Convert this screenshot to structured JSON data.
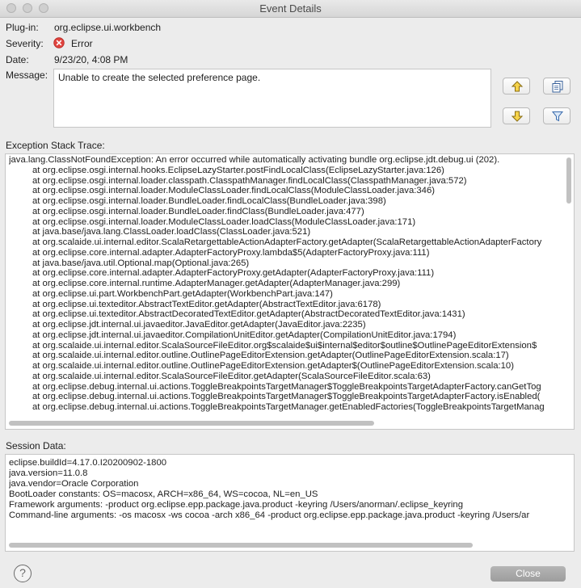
{
  "window": {
    "title": "Event Details"
  },
  "details": {
    "plugin_label": "Plug-in:",
    "plugin_value": "org.eclipse.ui.workbench",
    "severity_label": "Severity:",
    "severity_value": "Error",
    "date_label": "Date:",
    "date_value": "9/23/20, 4:08 PM",
    "message_label": "Message:",
    "message_value": "Unable to create the selected preference page."
  },
  "icons": {
    "severity": "error-icon",
    "previous": "arrow-up-icon",
    "next": "arrow-down-icon",
    "copy": "copy-icon",
    "filter": "filter-icon",
    "help": "help-icon"
  },
  "trace": {
    "label": "Exception Stack Trace:",
    "lines": [
      "java.lang.ClassNotFoundException: An error occurred while automatically activating bundle org.eclipse.jdt.debug.ui (202).",
      "at org.eclipse.osgi.internal.hooks.EclipseLazyStarter.postFindLocalClass(EclipseLazyStarter.java:126)",
      "at org.eclipse.osgi.internal.loader.classpath.ClasspathManager.findLocalClass(ClasspathManager.java:572)",
      "at org.eclipse.osgi.internal.loader.ModuleClassLoader.findLocalClass(ModuleClassLoader.java:346)",
      "at org.eclipse.osgi.internal.loader.BundleLoader.findLocalClass(BundleLoader.java:398)",
      "at org.eclipse.osgi.internal.loader.BundleLoader.findClass(BundleLoader.java:477)",
      "at org.eclipse.osgi.internal.loader.ModuleClassLoader.loadClass(ModuleClassLoader.java:171)",
      "at java.base/java.lang.ClassLoader.loadClass(ClassLoader.java:521)",
      "at org.scalaide.ui.internal.editor.ScalaRetargettableActionAdapterFactory.getAdapter(ScalaRetargettableActionAdapterFactory",
      "at org.eclipse.core.internal.adapter.AdapterFactoryProxy.lambda$5(AdapterFactoryProxy.java:111)",
      "at java.base/java.util.Optional.map(Optional.java:265)",
      "at org.eclipse.core.internal.adapter.AdapterFactoryProxy.getAdapter(AdapterFactoryProxy.java:111)",
      "at org.eclipse.core.internal.runtime.AdapterManager.getAdapter(AdapterManager.java:299)",
      "at org.eclipse.ui.part.WorkbenchPart.getAdapter(WorkbenchPart.java:147)",
      "at org.eclipse.ui.texteditor.AbstractTextEditor.getAdapter(AbstractTextEditor.java:6178)",
      "at org.eclipse.ui.texteditor.AbstractDecoratedTextEditor.getAdapter(AbstractDecoratedTextEditor.java:1431)",
      "at org.eclipse.jdt.internal.ui.javaeditor.JavaEditor.getAdapter(JavaEditor.java:2235)",
      "at org.eclipse.jdt.internal.ui.javaeditor.CompilationUnitEditor.getAdapter(CompilationUnitEditor.java:1794)",
      "at org.scalaide.ui.internal.editor.ScalaSourceFileEditor.org$scalaide$ui$internal$editor$outline$OutlinePageEditorExtension$",
      "at org.scalaide.ui.internal.editor.outline.OutlinePageEditorExtension.getAdapter(OutlinePageEditorExtension.scala:17)",
      "at org.scalaide.ui.internal.editor.outline.OutlinePageEditorExtension.getAdapter$(OutlinePageEditorExtension.scala:10)",
      "at org.scalaide.ui.internal.editor.ScalaSourceFileEditor.getAdapter(ScalaSourceFileEditor.scala:63)",
      "at org.eclipse.debug.internal.ui.actions.ToggleBreakpointsTargetManager$ToggleBreakpointsTargetAdapterFactory.canGetTog",
      "at org.eclipse.debug.internal.ui.actions.ToggleBreakpointsTargetManager$ToggleBreakpointsTargetAdapterFactory.isEnabled(",
      "at org.eclipse.debug.internal.ui.actions.ToggleBreakpointsTargetManager.getEnabledFactories(ToggleBreakpointsTargetManag"
    ]
  },
  "session": {
    "label": "Session Data:",
    "lines": [
      "eclipse.buildId=4.17.0.I20200902-1800",
      "java.version=11.0.8",
      "java.vendor=Oracle Corporation",
      "BootLoader constants: OS=macosx, ARCH=x86_64, WS=cocoa, NL=en_US",
      "Framework arguments:  -product org.eclipse.epp.package.java.product -keyring /Users/anorman/.eclipse_keyring",
      "Command-line arguments:  -os macosx -ws cocoa -arch x86_64 -product org.eclipse.epp.package.java.product -keyring /Users/ar"
    ]
  },
  "footer": {
    "help_glyph": "?",
    "close_label": "Close"
  }
}
